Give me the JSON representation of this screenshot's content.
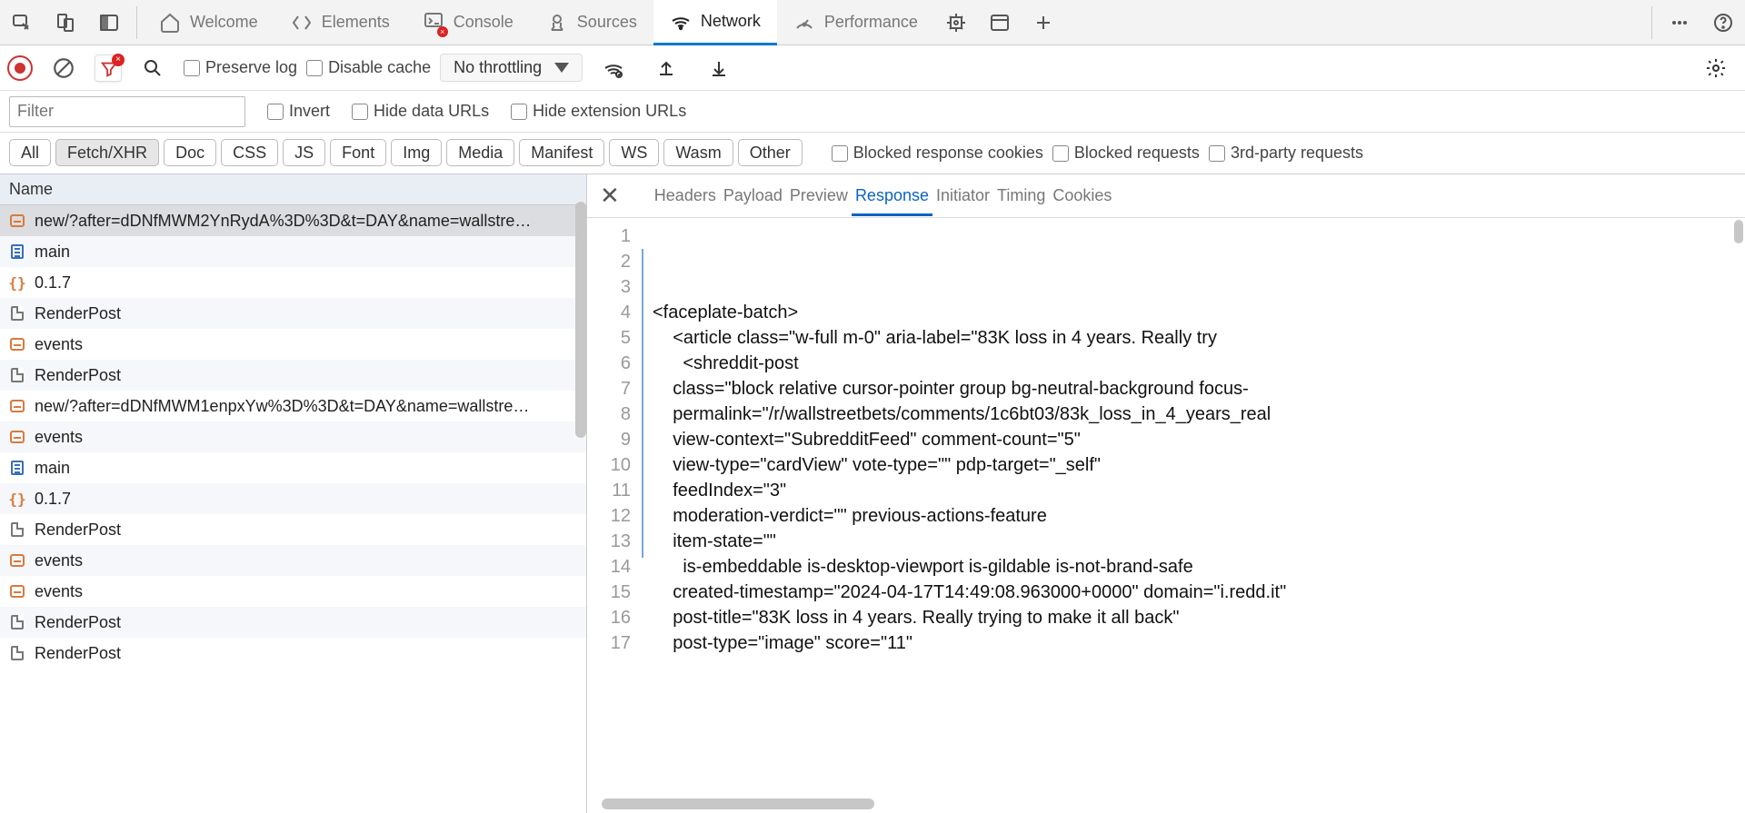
{
  "tabs": {
    "welcome": "Welcome",
    "elements": "Elements",
    "console": "Console",
    "sources": "Sources",
    "network": "Network",
    "performance": "Performance"
  },
  "toolbar": {
    "preserve_log": "Preserve log",
    "disable_cache": "Disable cache",
    "throttling": "No throttling"
  },
  "filter": {
    "placeholder": "Filter",
    "invert": "Invert",
    "hide_data_urls": "Hide data URLs",
    "hide_ext_urls": "Hide extension URLs"
  },
  "type_filters": [
    "All",
    "Fetch/XHR",
    "Doc",
    "CSS",
    "JS",
    "Font",
    "Img",
    "Media",
    "Manifest",
    "WS",
    "Wasm",
    "Other"
  ],
  "type_filter_active": "Fetch/XHR",
  "extra_filters": {
    "blocked_cookies": "Blocked response cookies",
    "blocked_requests": "Blocked requests",
    "third_party": "3rd-party requests"
  },
  "list": {
    "header": "Name",
    "rows": [
      {
        "icon": "xhr",
        "label": "new/?after=dDNfMWM2YnRydA%3D%3D&t=DAY&name=wallstre…",
        "selected": true
      },
      {
        "icon": "doc",
        "label": "main"
      },
      {
        "icon": "json",
        "label": "0.1.7"
      },
      {
        "icon": "file",
        "label": "RenderPost"
      },
      {
        "icon": "xhr",
        "label": "events"
      },
      {
        "icon": "file",
        "label": "RenderPost"
      },
      {
        "icon": "xhr",
        "label": "new/?after=dDNfMWM1enpxYw%3D%3D&t=DAY&name=wallstre…"
      },
      {
        "icon": "xhr",
        "label": "events"
      },
      {
        "icon": "doc",
        "label": "main"
      },
      {
        "icon": "json",
        "label": "0.1.7"
      },
      {
        "icon": "file",
        "label": "RenderPost"
      },
      {
        "icon": "xhr",
        "label": "events"
      },
      {
        "icon": "xhr",
        "label": "events"
      },
      {
        "icon": "file",
        "label": "RenderPost"
      },
      {
        "icon": "file",
        "label": "RenderPost"
      }
    ]
  },
  "detail_tabs": [
    "Headers",
    "Payload",
    "Preview",
    "Response",
    "Initiator",
    "Timing",
    "Cookies"
  ],
  "detail_tab_active": "Response",
  "code": {
    "lines": [
      "<faceplate-batch>",
      "",
      "    <article class=\"w-full m-0\" aria-label=\"83K loss in 4 years. Really try",
      "      <shreddit-post",
      "    class=\"block relative cursor-pointer group bg-neutral-background focus-",
      "    permalink=\"/r/wallstreetbets/comments/1c6bt03/83k_loss_in_4_years_real",
      "    view-context=\"SubredditFeed\" comment-count=\"5\"",
      "    view-type=\"cardView\" vote-type=\"\" pdp-target=\"_self\"",
      "    feedIndex=\"3\"",
      "    moderation-verdict=\"\" previous-actions-feature",
      "    item-state=\"\"",
      "      is-embeddable is-desktop-viewport is-gildable is-not-brand-safe",
      "",
      "",
      "    created-timestamp=\"2024-04-17T14:49:08.963000+0000\" domain=\"i.redd.it\"",
      "    post-title=\"83K loss in 4 years. Really trying to make it all back\"",
      "    post-type=\"image\" score=\"11\""
    ]
  }
}
